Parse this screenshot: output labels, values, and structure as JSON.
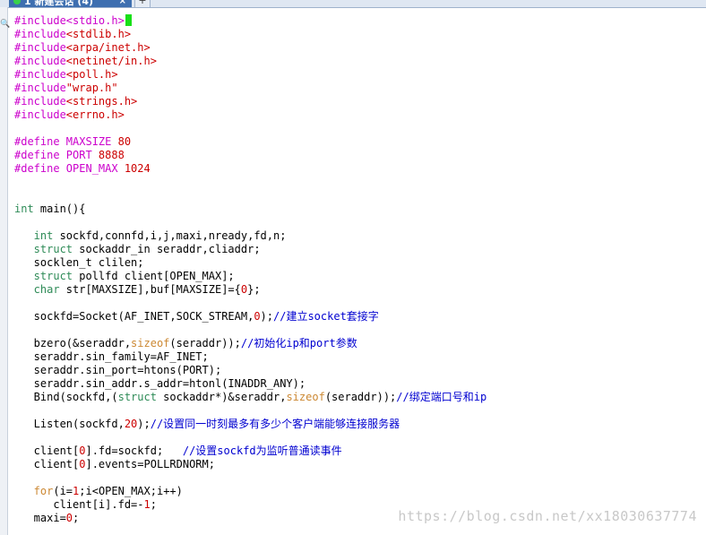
{
  "window": {
    "tab_label": "1 新建会话 (4)",
    "tab_close": "×",
    "new_tab": "+",
    "status_color": "#39d24a",
    "accent": "#3e6fb0"
  },
  "side_strip": {
    "icon": "search-icon",
    "glyph": "🔍"
  },
  "code": {
    "inc_stdio": "#include<stdio.h>",
    "inc_stdlib_a": "#include",
    "inc_stdlib_b": "<stdlib.h>",
    "inc_inet_a": "#include",
    "inc_inet_b": "<arpa/inet.h>",
    "inc_netin_a": "#include",
    "inc_netin_b": "<netinet/in.h>",
    "inc_poll_a": "#include",
    "inc_poll_b": "<poll.h>",
    "inc_wrap_a": "#include",
    "inc_wrap_b": "\"wrap.h\"",
    "inc_strings_a": "#include",
    "inc_strings_b": "<strings.h>",
    "inc_errno_a": "#include",
    "inc_errno_b": "<errno.h>",
    "def1_a": "#define MAXSIZE ",
    "def1_b": "80",
    "def2_a": "#define PORT ",
    "def2_b": "8888",
    "def3_a": "#define OPEN_MAX ",
    "def3_b": "1024",
    "main_a": "int",
    "main_b": " main(){",
    "decl1_a": "   int",
    "decl1_b": " sockfd,connfd,i,j,maxi,nready,fd,n;",
    "decl2_a": "   struct",
    "decl2_b": " sockaddr_in seraddr,cliaddr;",
    "decl3": "   socklen_t clilen;",
    "decl4_a": "   struct",
    "decl4_b": " pollfd client[OPEN_MAX];",
    "decl5_a": "   char",
    "decl5_b": " str[MAXSIZE],buf[MAXSIZE]={",
    "decl5_c": "0",
    "decl5_d": "};",
    "sock_a": "   sockfd=Socket(AF_INET,SOCK_STREAM,",
    "sock_b": "0",
    "sock_c": ");",
    "sock_d": "//建立socket套接字",
    "bzero_a": "   bzero(&seraddr,",
    "bzero_b": "sizeof",
    "bzero_c": "(seraddr));",
    "bzero_d": "//初始化ip和port参数",
    "fam": "   seraddr.sin_family=AF_INET;",
    "port": "   seraddr.sin_port=htons(PORT);",
    "addr": "   seraddr.sin_addr.s_addr=htonl(INADDR_ANY);",
    "bind_a": "   Bind(sockfd,(",
    "bind_b": "struct",
    "bind_c": " sockaddr*)&seraddr,",
    "bind_d": "sizeof",
    "bind_e": "(seraddr));",
    "bind_f": "//绑定端口号和ip",
    "listen_a": "   Listen(sockfd,",
    "listen_b": "20",
    "listen_c": ");",
    "listen_d": "//设置同一时刻最多有多少个客户端能够连接服务器",
    "cl0fd_a": "   client[",
    "cl0fd_b": "0",
    "cl0fd_c": "].fd=sockfd;   ",
    "cl0fd_d": "//设置sockfd为监听普通读事件",
    "cl0ev_a": "   client[",
    "cl0ev_b": "0",
    "cl0ev_c": "].events=POLLRDNORM;",
    "for_a": "   for",
    "for_b": "(i=",
    "for_c": "1",
    "for_d": ";i<OPEN_MAX;i++)",
    "clifd_a": "      client[i].fd=-",
    "clifd_b": "1",
    "clifd_c": ";",
    "maxi_a": "   maxi=",
    "maxi_b": "0",
    "maxi_c": ";"
  },
  "watermark": "https://blog.csdn.net/xx18030637774"
}
